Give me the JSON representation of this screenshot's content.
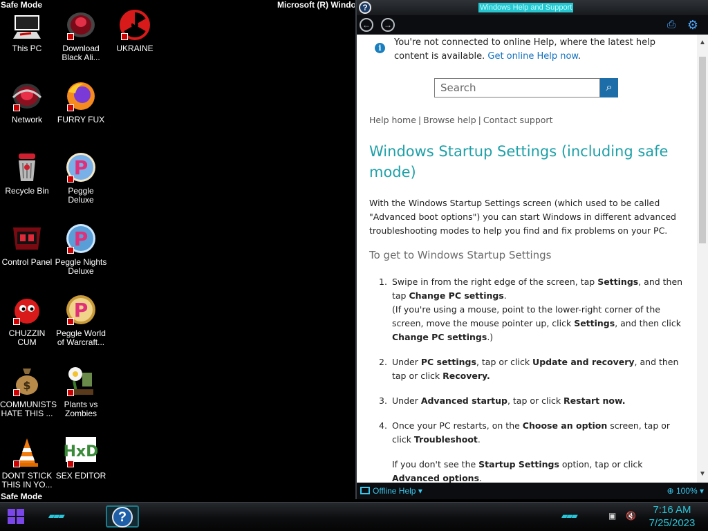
{
  "desktop": {
    "safe_mode_top": "Safe Mode",
    "safe_mode_bottom": "Safe Mode",
    "build_text": "Microsoft (R) Windo",
    "icons": [
      {
        "label": "This PC",
        "icon": "computer-icon"
      },
      {
        "label": "Download Black Ali...",
        "icon": "alienware-head-icon"
      },
      {
        "label": "UKRAINE",
        "icon": "radiation-icon"
      },
      {
        "label": "Network",
        "icon": "network-icon"
      },
      {
        "label": "FURRY FUX",
        "icon": "firefox-icon"
      },
      {
        "label": "Recycle Bin",
        "icon": "recycle-bin-icon"
      },
      {
        "label": "Peggle Deluxe",
        "icon": "peggle-icon"
      },
      {
        "label": "Control Panel",
        "icon": "control-panel-icon"
      },
      {
        "label": "Peggle Nights Deluxe",
        "icon": "peggle-nights-icon"
      },
      {
        "label": "CHUZZIN CUM",
        "icon": "chuzzle-icon"
      },
      {
        "label": "Peggle World of Warcraft...",
        "icon": "peggle-wow-icon"
      },
      {
        "label": "COMMUNISTS HATE THIS ...",
        "icon": "money-bag-icon"
      },
      {
        "label": "Plants vs Zombies",
        "icon": "plants-vs-zombies-icon"
      },
      {
        "label": "DONT STICK THIS IN YO...",
        "icon": "vlc-cone-icon"
      },
      {
        "label": "SEX EDITOR",
        "icon": "hxd-editor-icon"
      }
    ]
  },
  "help_window": {
    "title": "Windows Help and Support",
    "offline_notice": "You're not connected to online Help, where the latest help content is available.",
    "offline_link": "Get online Help now",
    "search_placeholder": "Search",
    "nav_links": [
      "Help home",
      "Browse help",
      "Contact support"
    ],
    "page_title": "Windows Startup Settings (including safe mode)",
    "intro": "With the Windows Startup Settings screen (which used to be called \"Advanced boot options\") you can start Windows in different advanced troubleshooting modes to help you find and fix problems on your PC.",
    "subheading": "To get to Windows Startup Settings",
    "steps": [
      {
        "num": "1.",
        "parts": [
          "Swipe in from the right edge of the screen, tap ",
          "Settings",
          ", and then tap ",
          "Change PC settings",
          "."
        ],
        "sub": [
          "(If you're using a mouse, point to the lower-right corner of the screen, move the mouse pointer up, click ",
          "Settings",
          ", and then click ",
          "Change PC settings",
          ".)"
        ]
      },
      {
        "num": "2.",
        "parts": [
          "Under ",
          "PC settings",
          ", tap or click ",
          "Update and recovery",
          ", and then tap or click ",
          "Recovery."
        ]
      },
      {
        "num": "3.",
        "parts": [
          "Under ",
          "Advanced startup",
          ", tap or click ",
          "Restart now."
        ]
      },
      {
        "num": "4.",
        "parts": [
          "Once your PC restarts, on the ",
          "Choose an option",
          " screen, tap or click ",
          "Troubleshoot",
          "."
        ],
        "sub": [
          "If you don't see the ",
          "Startup Settings",
          " option, tap or click ",
          "Advanced options",
          "."
        ]
      }
    ],
    "status_left": "Offline Help",
    "zoom": "100%"
  },
  "taskbar": {
    "time": "7:16 AM",
    "date": "7/25/2023"
  },
  "colors": {
    "accent": "#2ac5d8",
    "title_teal": "#1ea0a8",
    "link": "#0f6fbd",
    "start_purple": "#7a46ea"
  }
}
